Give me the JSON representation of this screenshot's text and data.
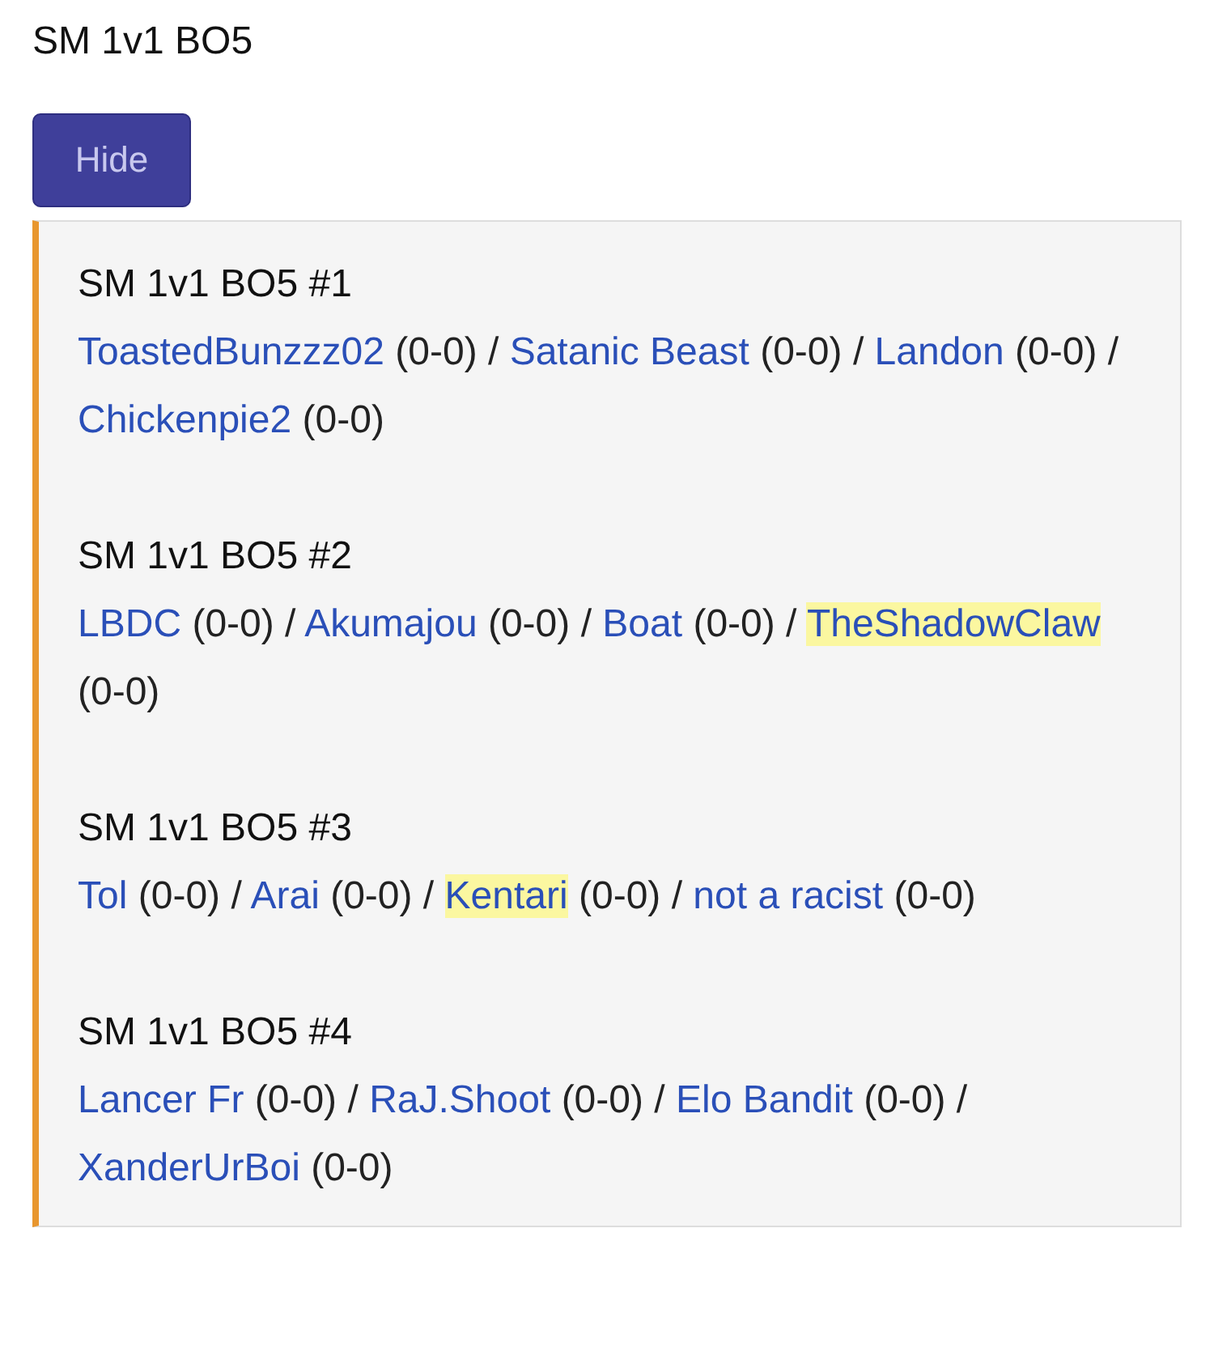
{
  "title": "SM 1v1 BO5",
  "hide_button": "Hide",
  "separator": "/",
  "matches": [
    {
      "title": "SM 1v1 BO5 #1",
      "players": [
        {
          "name": "ToastedBunzzz02",
          "score": "(0-0)",
          "highlighted": false
        },
        {
          "name": "Satanic Beast",
          "score": "(0-0)",
          "highlighted": false
        },
        {
          "name": "Landon",
          "score": "(0-0)",
          "highlighted": false
        },
        {
          "name": "Chickenpie2",
          "score": "(0-0)",
          "highlighted": false
        }
      ]
    },
    {
      "title": "SM 1v1 BO5 #2",
      "players": [
        {
          "name": "LBDC",
          "score": "(0-0)",
          "highlighted": false
        },
        {
          "name": "Akumajou",
          "score": "(0-0)",
          "highlighted": false
        },
        {
          "name": "Boat",
          "score": "(0-0)",
          "highlighted": false
        },
        {
          "name": "TheShadowClaw",
          "score": "(0-0)",
          "highlighted": true
        }
      ]
    },
    {
      "title": "SM 1v1 BO5 #3",
      "players": [
        {
          "name": "Tol",
          "score": "(0-0)",
          "highlighted": false
        },
        {
          "name": "Arai",
          "score": "(0-0)",
          "highlighted": false
        },
        {
          "name": "Kentari",
          "score": "(0-0)",
          "highlighted": true
        },
        {
          "name": "not a racist",
          "score": "(0-0)",
          "highlighted": false
        }
      ]
    },
    {
      "title": "SM 1v1 BO5 #4",
      "players": [
        {
          "name": "Lancer Fr",
          "score": "(0-0)",
          "highlighted": false
        },
        {
          "name": "RaJ.Shoot",
          "score": "(0-0)",
          "highlighted": false
        },
        {
          "name": "Elo Bandit",
          "score": "(0-0)",
          "highlighted": false
        },
        {
          "name": "XanderUrBoi",
          "score": "(0-0)",
          "highlighted": false
        }
      ]
    }
  ]
}
